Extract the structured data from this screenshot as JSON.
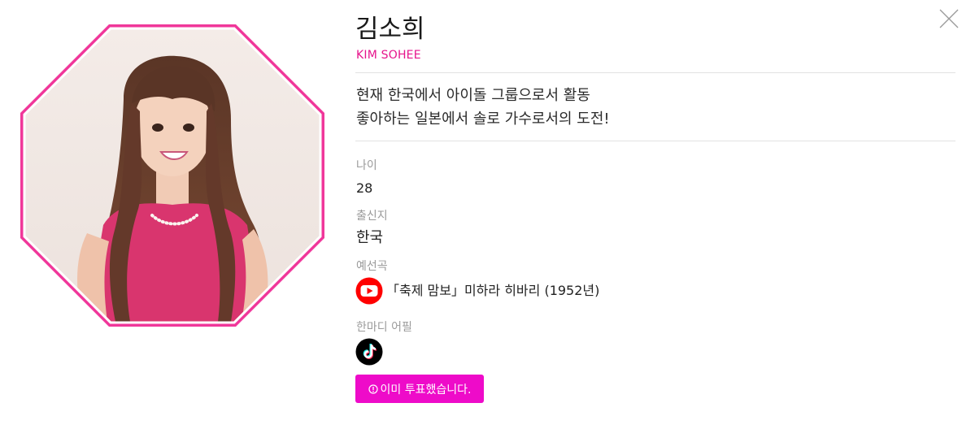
{
  "profile": {
    "name": "김소희",
    "name_en": "KIM SOHEE",
    "intro_lines": [
      "현재 한국에서 아이돌 그룹으로서 활동",
      "좋아하는 일본에서 솔로 가수로서의 도전!"
    ]
  },
  "fields": {
    "age_label": "나이",
    "age_value": "28",
    "origin_label": "출신지",
    "origin_value": "한국",
    "song_label": "예선곡",
    "song_value": "「축제 맘보」미하라 히바리 (1952년)",
    "appeal_label": "한마디 어필"
  },
  "vote": {
    "label": "이미 투표했습니다."
  },
  "icons": {
    "close": "close-icon",
    "youtube": "youtube-icon",
    "tiktok": "tiktok-icon",
    "info": "info-circle-icon"
  },
  "colors": {
    "accent": "#e6148c",
    "button": "#ee0bc9",
    "frame": "#f0379a",
    "youtube": "#ff0000"
  }
}
